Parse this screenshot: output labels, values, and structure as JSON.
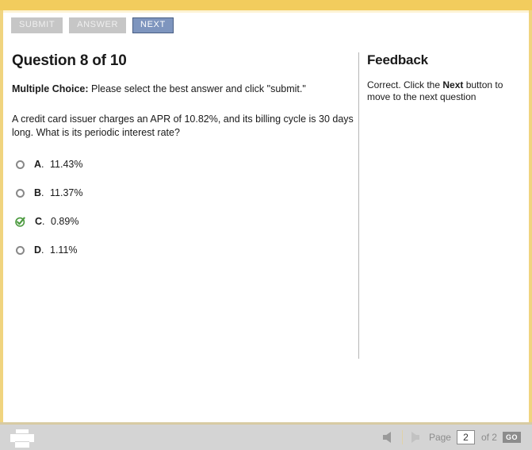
{
  "theme": {
    "accent_gold": "#f2cc5d",
    "active_button_blue": "#7e95be",
    "disabled_button_grey": "#c6c6c6",
    "correct_green": "#4c9a3f",
    "bottom_bar_grey": "#d4d4d4"
  },
  "toolbar": {
    "submit_label": "SUBMIT",
    "answer_label": "ANSWER",
    "next_label": "NEXT"
  },
  "question": {
    "title": "Question 8 of 10",
    "instruction_bold": "Multiple Choice:",
    "instruction_rest": " Please select the best answer and click \"submit.\"",
    "stem": "A credit card issuer charges an APR of 10.82%, and its billing cycle is 30 days long. What is its periodic interest rate?",
    "options": [
      {
        "letter": "A",
        "text": "11.43%",
        "state": "unselected"
      },
      {
        "letter": "B",
        "text": "11.37%",
        "state": "unselected"
      },
      {
        "letter": "C",
        "text": "0.89%",
        "state": "correct"
      },
      {
        "letter": "D",
        "text": "1.11%",
        "state": "unselected"
      }
    ]
  },
  "feedback": {
    "title": "Feedback",
    "text_before": "Correct. Click the ",
    "text_bold": "Next",
    "text_after": " button to move to the next question"
  },
  "footer": {
    "print_icon": "printer-icon",
    "prev_icon": "arrow-left-icon",
    "next_icon": "arrow-right-icon",
    "page_label": "Page",
    "page_value": "2",
    "of_label": "of 2",
    "go_label": "GO"
  }
}
